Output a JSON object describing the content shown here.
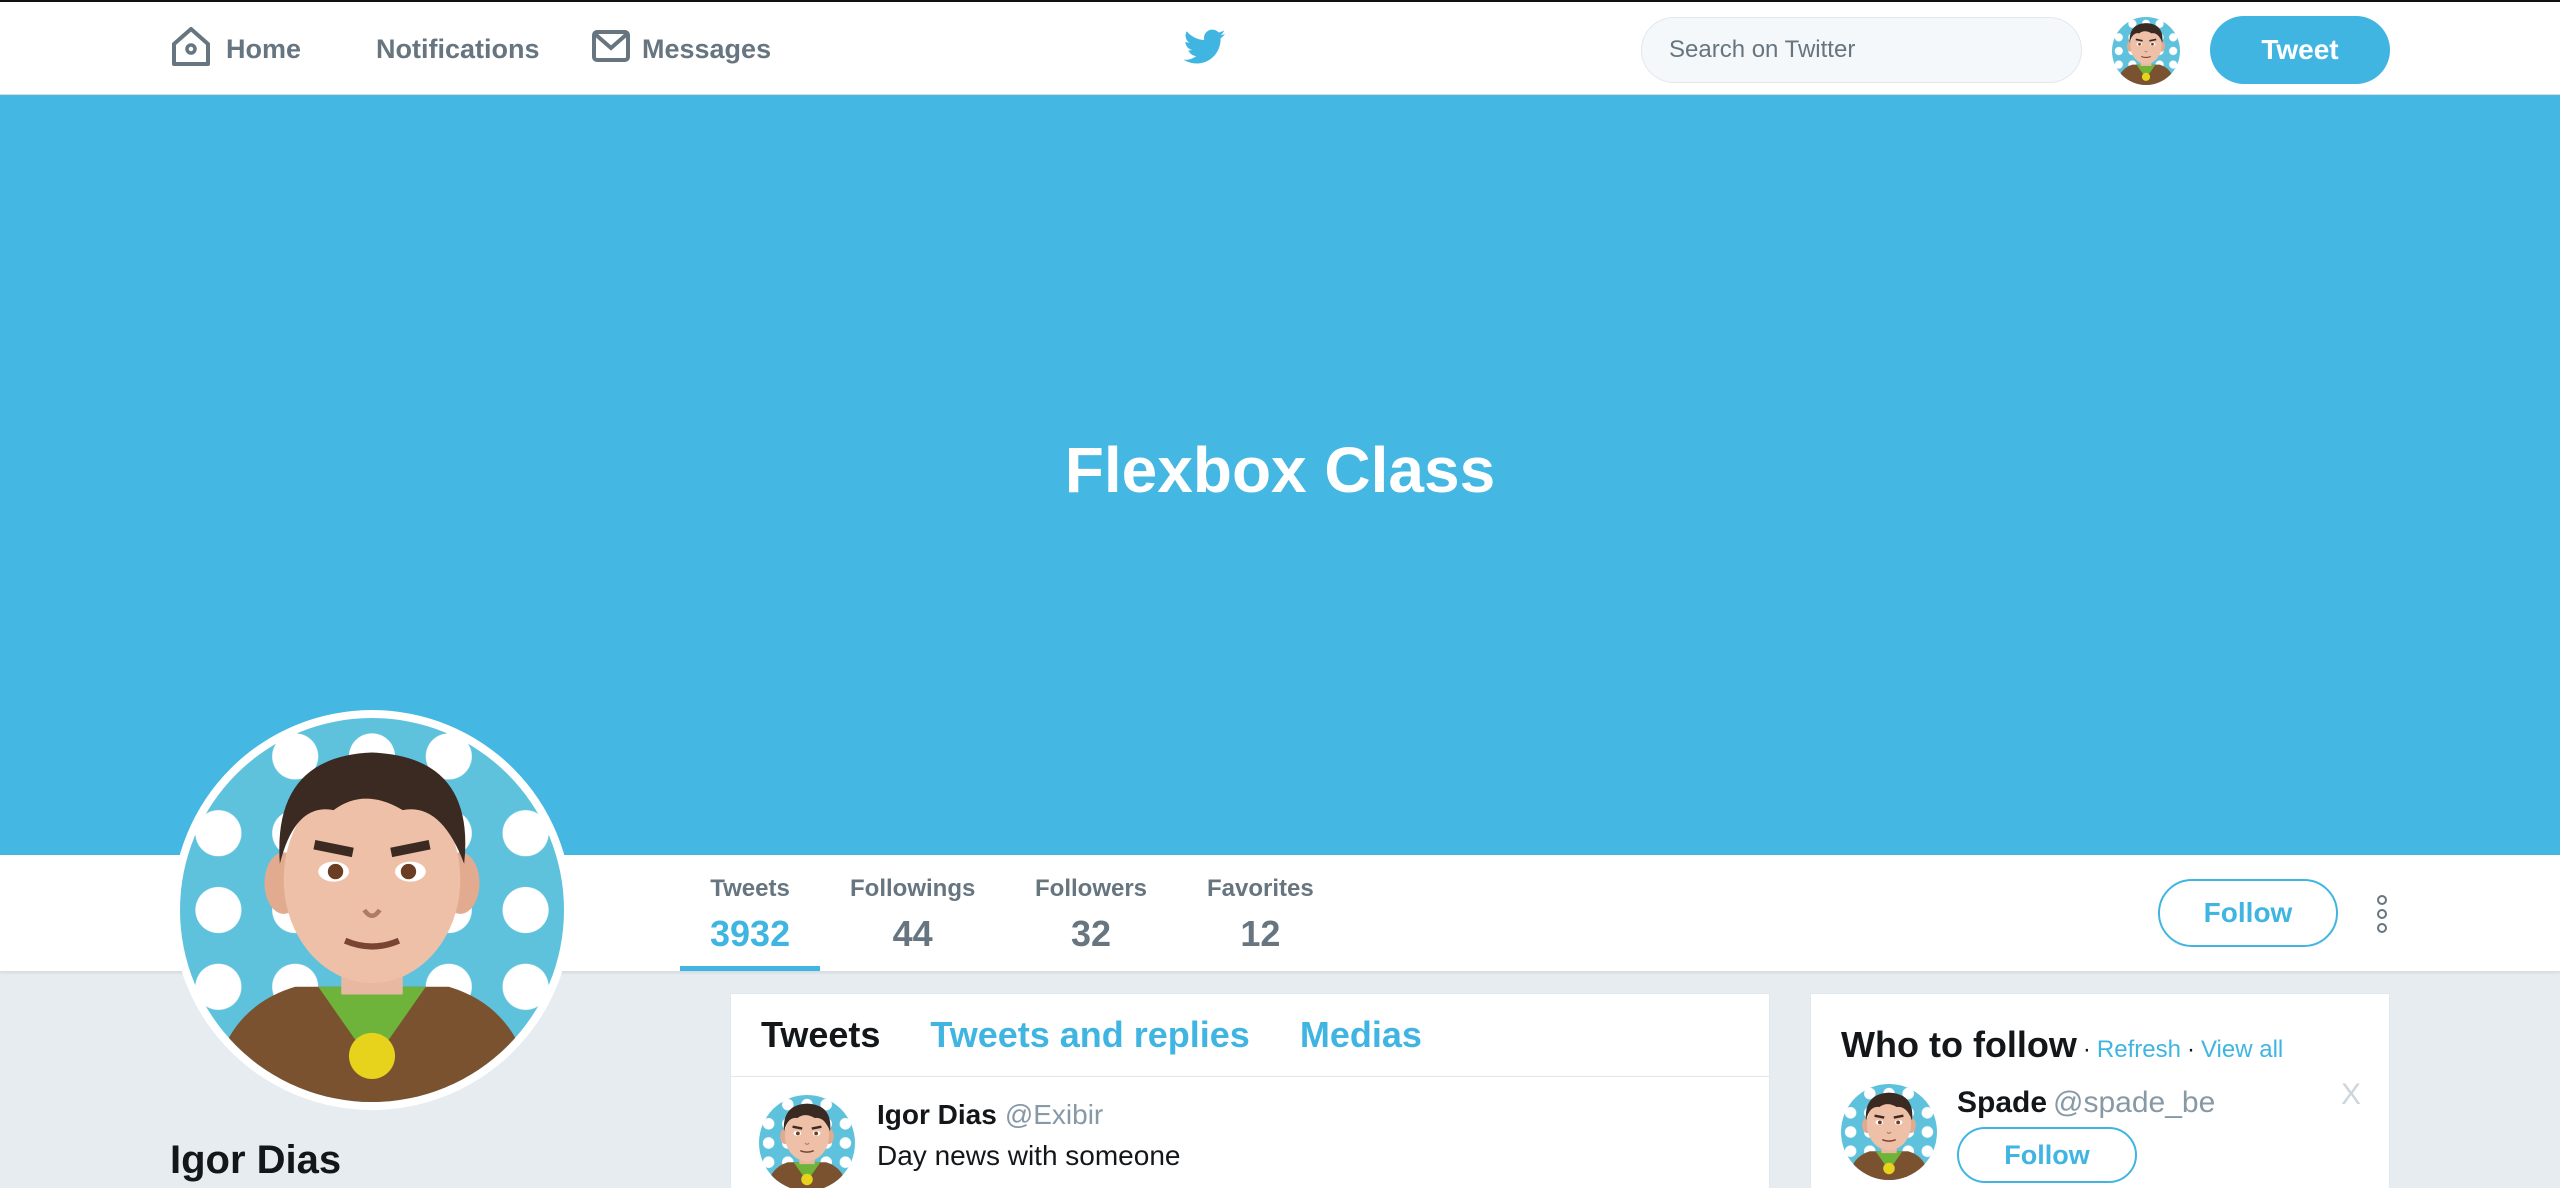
{
  "nav": {
    "home_label": "Home",
    "notifications_label": "Notifications",
    "messages_label": "Messages"
  },
  "search": {
    "placeholder": "Search on Twitter"
  },
  "header": {
    "tweet_button": "Tweet"
  },
  "banner": {
    "title": "Flexbox Class"
  },
  "stats": [
    {
      "label": "Tweets",
      "value": "3932"
    },
    {
      "label": "Followings",
      "value": "44"
    },
    {
      "label": "Followers",
      "value": "32"
    },
    {
      "label": "Favorites",
      "value": "12"
    }
  ],
  "profile": {
    "name": "Igor Dias",
    "follow_button": "Follow"
  },
  "timeline": {
    "tabs": [
      "Tweets",
      "Tweets and replies",
      "Medias"
    ],
    "tweets": [
      {
        "name": "Igor Dias",
        "handle": "@Exibir",
        "text": "Day news with someone"
      }
    ]
  },
  "who_to_follow": {
    "title": "Who to follow",
    "separator": "·",
    "refresh": "Refresh",
    "view_all": "View all",
    "users": [
      {
        "name": "Spade",
        "handle": "@spade_be",
        "follow": "Follow",
        "close": "X"
      }
    ]
  },
  "colors": {
    "accent": "#40b5e2",
    "banner": "#44b7e2",
    "background": "#e6ecf0"
  }
}
